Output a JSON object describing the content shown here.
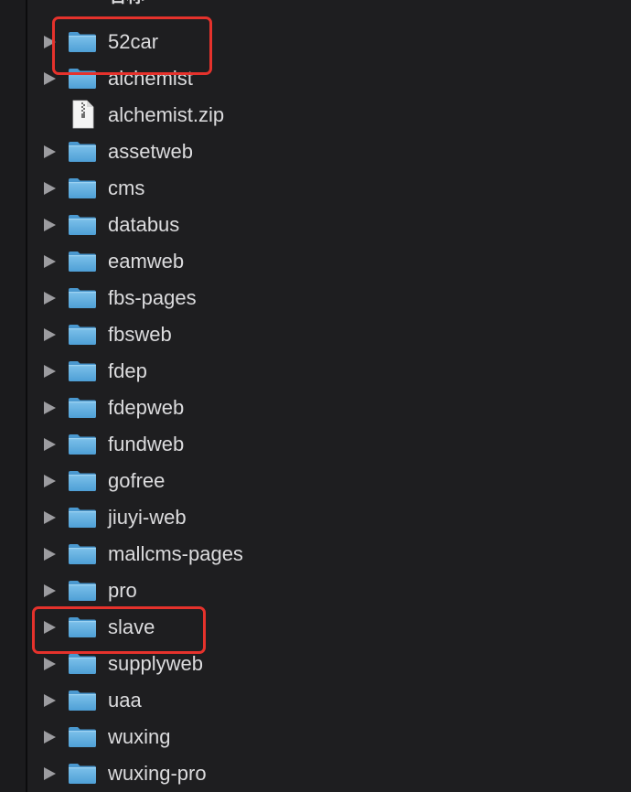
{
  "header": {
    "column_label": "名称",
    "sort_indicator": "^"
  },
  "items": [
    {
      "name": "52car",
      "type": "folder",
      "expandable": true,
      "highlighted": true
    },
    {
      "name": "alchemist",
      "type": "folder",
      "expandable": true,
      "highlighted": false
    },
    {
      "name": "alchemist.zip",
      "type": "zip-file",
      "expandable": false,
      "highlighted": false
    },
    {
      "name": "assetweb",
      "type": "folder",
      "expandable": true,
      "highlighted": false
    },
    {
      "name": "cms",
      "type": "folder",
      "expandable": true,
      "highlighted": false
    },
    {
      "name": "databus",
      "type": "folder",
      "expandable": true,
      "highlighted": false
    },
    {
      "name": "eamweb",
      "type": "folder",
      "expandable": true,
      "highlighted": false
    },
    {
      "name": "fbs-pages",
      "type": "folder",
      "expandable": true,
      "highlighted": false
    },
    {
      "name": "fbsweb",
      "type": "folder",
      "expandable": true,
      "highlighted": false
    },
    {
      "name": "fdep",
      "type": "folder",
      "expandable": true,
      "highlighted": false
    },
    {
      "name": "fdepweb",
      "type": "folder",
      "expandable": true,
      "highlighted": false
    },
    {
      "name": "fundweb",
      "type": "folder",
      "expandable": true,
      "highlighted": false
    },
    {
      "name": "gofree",
      "type": "folder",
      "expandable": true,
      "highlighted": false
    },
    {
      "name": "jiuyi-web",
      "type": "folder",
      "expandable": true,
      "highlighted": false
    },
    {
      "name": "mallcms-pages",
      "type": "folder",
      "expandable": true,
      "highlighted": false
    },
    {
      "name": "pro",
      "type": "folder",
      "expandable": true,
      "highlighted": false
    },
    {
      "name": "slave",
      "type": "folder",
      "expandable": true,
      "highlighted": true
    },
    {
      "name": "supplyweb",
      "type": "folder",
      "expandable": true,
      "highlighted": false
    },
    {
      "name": "uaa",
      "type": "folder",
      "expandable": true,
      "highlighted": false
    },
    {
      "name": "wuxing",
      "type": "folder",
      "expandable": true,
      "highlighted": false
    },
    {
      "name": "wuxing-pro",
      "type": "folder",
      "expandable": true,
      "highlighted": false
    }
  ],
  "colors": {
    "background": "#1e1e20",
    "text": "#dcdcde",
    "folder": "#5aa9dc",
    "highlight_box": "#e5322c",
    "disclosure": "#9c9ca0"
  },
  "icons": {
    "folder": "folder-icon",
    "zip": "zip-file-icon",
    "disclosure": "disclosure-triangle-icon"
  }
}
